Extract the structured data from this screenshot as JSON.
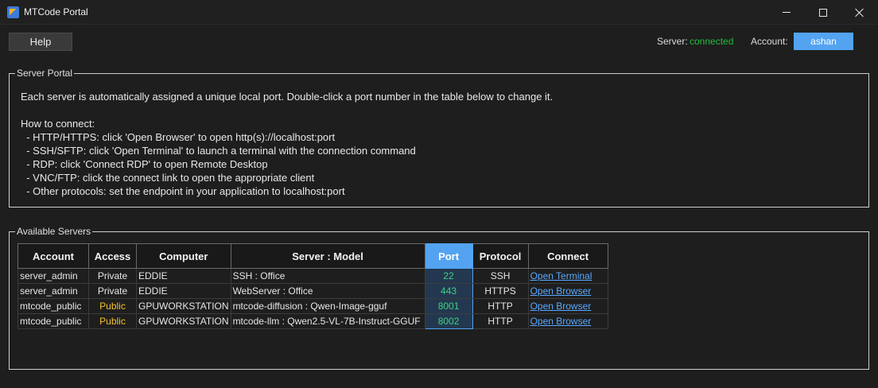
{
  "window": {
    "title": "MTCode Portal"
  },
  "toolbar": {
    "help_label": "Help",
    "server_label": "Server:",
    "server_status": "connected",
    "account_label": "Account:",
    "account_name": "ashan"
  },
  "portal": {
    "legend": "Server Portal",
    "intro": "Each server is automatically assigned a unique local port. Double-click a port number in the table below to change it.",
    "how_to": "How to connect:",
    "instructions": [
      "  - HTTP/HTTPS: click 'Open Browser' to open http(s)://localhost:port",
      "  - SSH/SFTP: click 'Open Terminal' to launch a terminal with the connection command",
      "  - RDP: click 'Connect RDP' to open Remote Desktop",
      "  - VNC/FTP: click the connect link to open the appropriate client",
      "  - Other protocols: set the endpoint in your application to localhost:port"
    ]
  },
  "servers": {
    "legend": "Available Servers",
    "columns": [
      "Account",
      "Access",
      "Computer",
      "Server : Model",
      "Port",
      "Protocol",
      "Connect"
    ],
    "rows": [
      {
        "account": "server_admin",
        "access": "Private",
        "computer": "EDDIE",
        "server_model": "SSH : Office",
        "port": "22",
        "protocol": "SSH",
        "connect": "Open Terminal"
      },
      {
        "account": "server_admin",
        "access": "Private",
        "computer": "EDDIE",
        "server_model": "WebServer : Office",
        "port": "443",
        "protocol": "HTTPS",
        "connect": "Open Browser"
      },
      {
        "account": "mtcode_public",
        "access": "Public",
        "computer": "GPUWORKSTATION",
        "server_model": "mtcode-diffusion : Qwen-Image-gguf",
        "port": "8001",
        "protocol": "HTTP",
        "connect": "Open Browser"
      },
      {
        "account": "mtcode_public",
        "access": "Public",
        "computer": "GPUWORKSTATION",
        "server_model": "mtcode-llm : Qwen2.5-VL-7B-Instruct-GGUF",
        "port": "8002",
        "protocol": "HTTP",
        "connect": "Open Browser"
      }
    ]
  },
  "colors": {
    "accent": "#53a3f0",
    "connected": "#1fbf3a",
    "public": "#f2c12e",
    "port_text": "#3fd083",
    "link": "#5aa9ff"
  }
}
